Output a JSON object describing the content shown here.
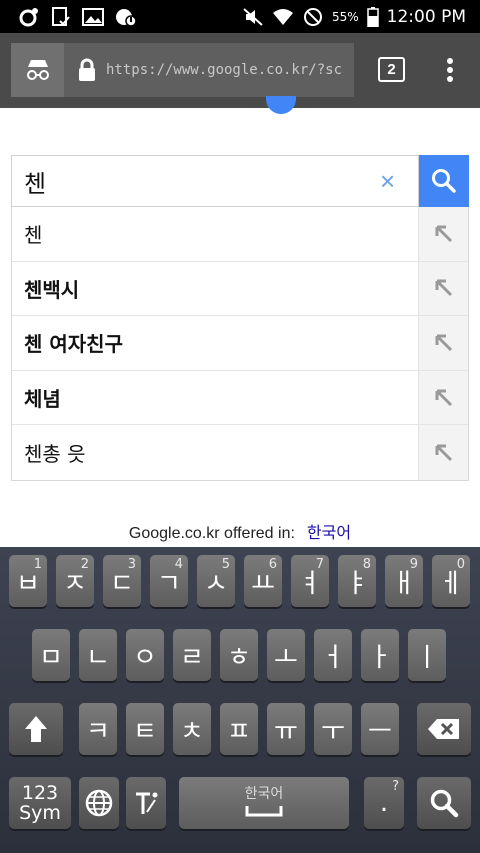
{
  "status_bar": {
    "battery_percent": "55%",
    "time": "12:00 PM"
  },
  "browser": {
    "url": "https://www.google.co.kr/?sc",
    "tab_count": "2"
  },
  "search": {
    "query": "첸",
    "clear_symbol": "×"
  },
  "suggestions": [
    {
      "text": "첸",
      "bold": false
    },
    {
      "text": "첸백시",
      "bold": true
    },
    {
      "text": "첸 여자친구",
      "bold": true
    },
    {
      "text": "체념",
      "bold": true
    },
    {
      "text": "첸총 읏",
      "bold": false
    }
  ],
  "footer": {
    "offered_in": "Google.co.kr offered in:",
    "language_link": "한국어"
  },
  "keyboard": {
    "row1": [
      {
        "label": "ㅂ",
        "hint": "1"
      },
      {
        "label": "ㅈ",
        "hint": "2"
      },
      {
        "label": "ㄷ",
        "hint": "3"
      },
      {
        "label": "ㄱ",
        "hint": "4"
      },
      {
        "label": "ㅅ",
        "hint": "5"
      },
      {
        "label": "ㅛ",
        "hint": "6"
      },
      {
        "label": "ㅕ",
        "hint": "7"
      },
      {
        "label": "ㅑ",
        "hint": "8"
      },
      {
        "label": "ㅐ",
        "hint": "9"
      },
      {
        "label": "ㅔ",
        "hint": "0"
      }
    ],
    "row2": [
      "ㅁ",
      "ㄴ",
      "ㅇ",
      "ㄹ",
      "ㅎ",
      "ㅗ",
      "ㅓ",
      "ㅏ",
      "ㅣ"
    ],
    "row3": [
      "ㅋ",
      "ㅌ",
      "ㅊ",
      "ㅍ",
      "ㅠ",
      "ㅜ",
      "ㅡ"
    ],
    "sym_label_line1": "123",
    "sym_label_line2": "Sym",
    "space_label": "한국어",
    "period_label": ".",
    "period_hint": "?"
  }
}
